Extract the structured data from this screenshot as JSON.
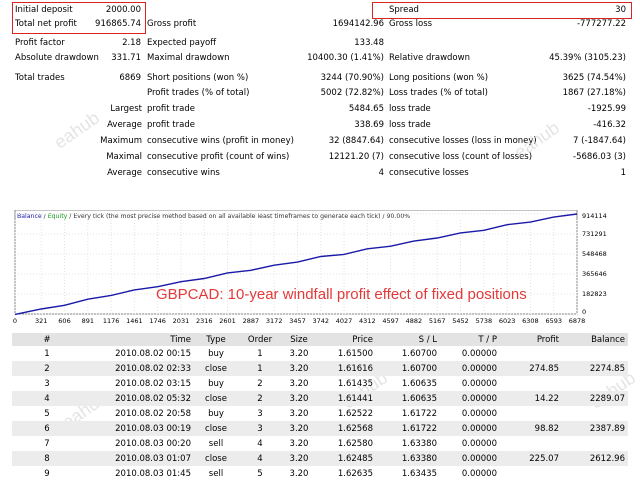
{
  "summary": {
    "initial_deposit": {
      "label": "Initial deposit",
      "value": "2000.00"
    },
    "total_net_profit": {
      "label": "Total net profit",
      "value": "916865.74"
    },
    "gross_profit": {
      "label": "Gross profit",
      "value": "1694142.96"
    },
    "gross_loss": {
      "label": "Gross loss",
      "value": "-777277.22"
    },
    "spread": {
      "label": "Spread",
      "value": "30"
    },
    "profit_factor": {
      "label": "Profit factor",
      "value": "2.18"
    },
    "expected_payoff": {
      "label": "Expected payoff",
      "value": "133.48"
    },
    "absolute_drawdown": {
      "label": "Absolute drawdown",
      "value": "331.71"
    },
    "maximal_drawdown": {
      "label": "Maximal drawdown",
      "value": "10400.30 (1.41%)"
    },
    "relative_drawdown": {
      "label": "Relative drawdown",
      "value": "45.39% (3105.23)"
    },
    "total_trades": {
      "label": "Total trades",
      "value": "6869"
    },
    "short_positions": {
      "label": "Short positions (won %)",
      "value": "3244 (70.90%)"
    },
    "long_positions": {
      "label": "Long positions (won %)",
      "value": "3625 (74.54%)"
    },
    "profit_trades": {
      "label": "Profit trades (% of total)",
      "value": "5002 (72.82%)"
    },
    "loss_trades": {
      "label": "Loss trades (% of total)",
      "value": "1867 (27.18%)"
    },
    "largest": {
      "label": "Largest",
      "profit_label": "profit trade",
      "profit_value": "5484.65",
      "loss_label": "loss trade",
      "loss_value": "-1925.99"
    },
    "average": {
      "label": "Average",
      "profit_label": "profit trade",
      "profit_value": "338.69",
      "loss_label": "loss trade",
      "loss_value": "-416.32"
    },
    "maximum": {
      "label": "Maximum",
      "wins_label": "consecutive wins (profit in money)",
      "wins_value": "32 (8847.64)",
      "losses_label": "consecutive losses (loss in money)",
      "losses_value": "7 (-1847.64)"
    },
    "maximal": {
      "label": "Maximal",
      "profit_label": "consecutive profit (count of wins)",
      "profit_value": "12121.20 (7)",
      "loss_label": "consecutive loss (count of losses)",
      "loss_value": "-5686.03 (3)"
    },
    "average_consec": {
      "label": "Average",
      "wins_label": "consecutive wins",
      "wins_value": "4",
      "losses_label": "consecutive losses",
      "losses_value": "1"
    }
  },
  "chart_header": {
    "balance": "Balance",
    "sep": " / ",
    "equity": "Equity",
    "rest": " / Every tick (the most precise method based on all available least timeframes to generate each tick) / 90.00%"
  },
  "chart_overlay_title": "GBPCAD: 10-year windfall profit effect of fixed positions",
  "chart_data": {
    "type": "line",
    "x_ticks": [
      "0",
      "321",
      "606",
      "891",
      "1176",
      "1461",
      "1746",
      "2031",
      "2316",
      "2601",
      "2887",
      "3172",
      "3457",
      "3742",
      "4027",
      "4312",
      "4597",
      "4882",
      "5167",
      "5452",
      "5738",
      "6023",
      "6308",
      "6593",
      "6878"
    ],
    "y_ticks": [
      "914114",
      "731291",
      "548468",
      "365646",
      "182823",
      "0"
    ],
    "xlim": [
      0,
      6878
    ],
    "ylim": [
      0,
      950000
    ],
    "series": [
      {
        "name": "Balance",
        "color": "#1a1aa8",
        "x": [
          0,
          321,
          606,
          891,
          1176,
          1461,
          1746,
          2031,
          2316,
          2601,
          2887,
          3172,
          3457,
          3742,
          4027,
          4312,
          4597,
          4882,
          5167,
          5452,
          5738,
          6023,
          6308,
          6593,
          6878
        ],
        "y": [
          2000,
          40000,
          85000,
          130000,
          175000,
          215000,
          255000,
          290000,
          330000,
          370000,
          405000,
          440000,
          480000,
          520000,
          550000,
          590000,
          625000,
          660000,
          700000,
          735000,
          770000,
          810000,
          845000,
          880000,
          918866
        ]
      }
    ]
  },
  "watermark": "eahub",
  "trades": {
    "headers": [
      "#",
      "Time",
      "Type",
      "Order",
      "Size",
      "Price",
      "S / L",
      "T / P",
      "Profit",
      "Balance"
    ],
    "rows": [
      [
        "1",
        "2010.08.02 00:15",
        "buy",
        "1",
        "3.20",
        "1.61500",
        "1.60700",
        "0.00000",
        "",
        ""
      ],
      [
        "2",
        "2010.08.02 02:33",
        "close",
        "1",
        "3.20",
        "1.61616",
        "1.60700",
        "0.00000",
        "274.85",
        "2274.85"
      ],
      [
        "3",
        "2010.08.02 03:15",
        "buy",
        "2",
        "3.20",
        "1.61435",
        "1.60635",
        "0.00000",
        "",
        ""
      ],
      [
        "4",
        "2010.08.02 05:32",
        "close",
        "2",
        "3.20",
        "1.61441",
        "1.60635",
        "0.00000",
        "14.22",
        "2289.07"
      ],
      [
        "5",
        "2010.08.02 20:58",
        "buy",
        "3",
        "3.20",
        "1.62522",
        "1.61722",
        "0.00000",
        "",
        ""
      ],
      [
        "6",
        "2010.08.03 00:19",
        "close",
        "3",
        "3.20",
        "1.62568",
        "1.61722",
        "0.00000",
        "98.82",
        "2387.89"
      ],
      [
        "7",
        "2010.08.03 00:20",
        "sell",
        "4",
        "3.20",
        "1.62580",
        "1.63380",
        "0.00000",
        "",
        ""
      ],
      [
        "8",
        "2010.08.03 01:07",
        "close",
        "4",
        "3.20",
        "1.62485",
        "1.63380",
        "0.00000",
        "225.07",
        "2612.96"
      ],
      [
        "9",
        "2010.08.03 01:45",
        "sell",
        "5",
        "3.20",
        "1.62635",
        "1.63435",
        "0.00000",
        "",
        ""
      ]
    ]
  }
}
